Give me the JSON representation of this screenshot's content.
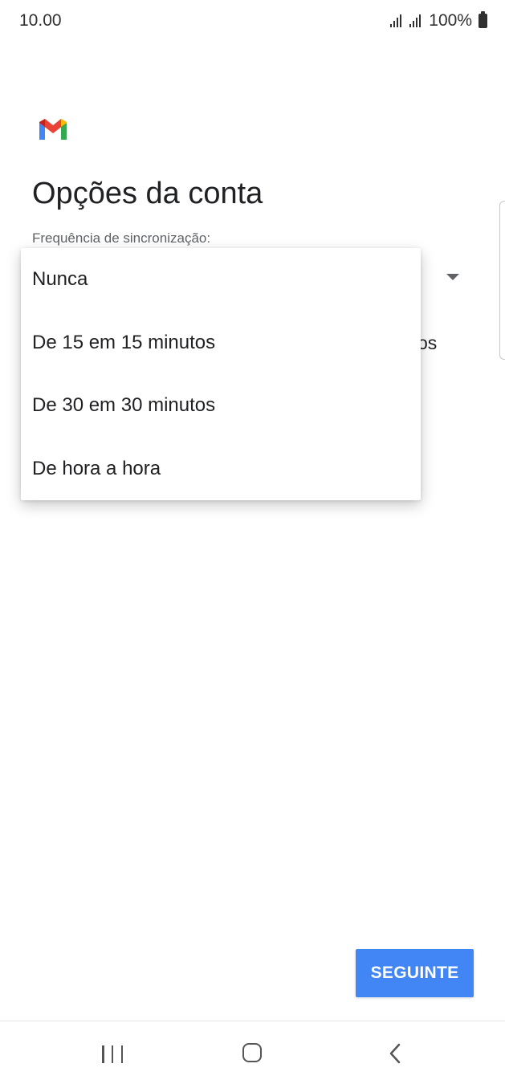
{
  "status_bar": {
    "time": "10.00",
    "battery_text": "100%"
  },
  "header": {
    "title": "Opções da conta"
  },
  "sync": {
    "label": "Frequência de sincronização:",
    "options": [
      "Nunca",
      "De 15 em 15 minutos",
      "De 30 em 30 minutos",
      "De hora a hora"
    ],
    "behind_text": "os"
  },
  "actions": {
    "next_label": "SEGUINTE"
  },
  "icons": {
    "logo": "gmail-logo-icon",
    "signal": "signal-icon",
    "battery": "battery-icon",
    "dropdown": "dropdown-arrow-icon",
    "recents": "recents-icon",
    "home": "home-icon",
    "back": "back-icon"
  },
  "colors": {
    "primary_button": "#4285f4",
    "gmail_red": "#ea4335",
    "gmail_blue": "#4285f4",
    "gmail_green": "#34a853",
    "gmail_yellow": "#fbbc04"
  }
}
